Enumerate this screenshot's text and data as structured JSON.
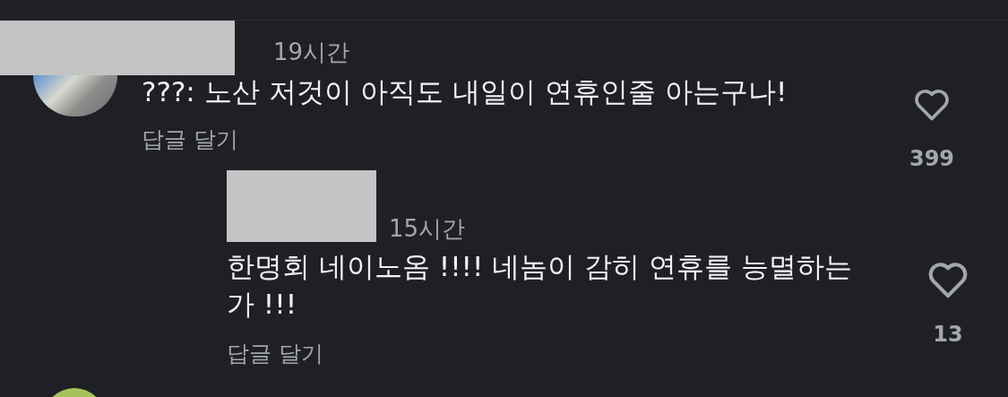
{
  "comments": [
    {
      "time": "19시간",
      "text": "???: 노산 저것이 아직도 내일이 연휴인줄 아는구나!",
      "reply_action": "답글 달기",
      "like_count": "399",
      "replies": [
        {
          "time": "15시간",
          "text": "한명회 네이노옴 !!!! 네놈이 감히 연휴를 능멸하는가 !!!",
          "reply_action": "답글 달기",
          "like_count": "13"
        }
      ]
    }
  ]
}
